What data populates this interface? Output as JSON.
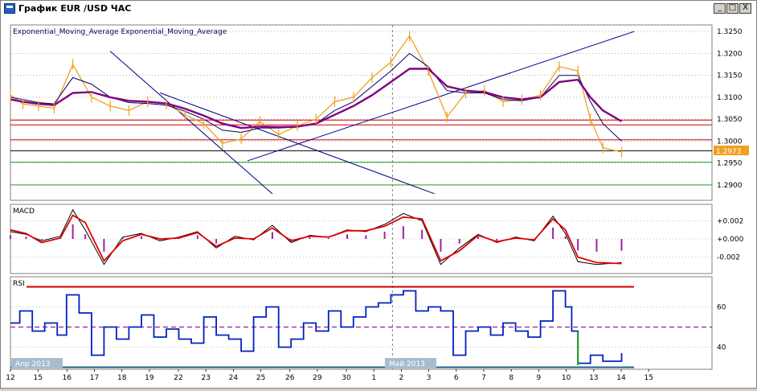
{
  "window": {
    "title": "График EUR /USD  ЧАС",
    "minimize_label": "_",
    "maximize_label": "□",
    "close_label": "X"
  },
  "colors": {
    "price": "#f0a020",
    "ema_fast": "#000060",
    "ema_slow": "#800080",
    "macd_line": "#000000",
    "macd_signal": "#e00000",
    "macd_hist": "#a020a0",
    "rsi": "#0020c0",
    "red_level": "#d00000",
    "green_level": "#20a020",
    "trendline": "#000080",
    "grid": "#808080"
  },
  "chart_data": [
    {
      "type": "line",
      "panel": "price",
      "label": "Exponential_Moving_Average  Exponential_Moving_Average",
      "ylim": [
        1.2865,
        1.3265
      ],
      "yticks": [
        "1.3250",
        "1.3200",
        "1.3150",
        "1.3100",
        "1.3050",
        "1.3000",
        "1.2950",
        "1.2900"
      ],
      "current_price": "1.2973",
      "x": [
        0,
        4,
        9,
        14,
        20,
        26,
        32,
        38,
        44,
        50,
        56,
        62,
        68,
        74,
        80,
        86,
        92,
        98,
        104,
        110,
        116,
        122,
        128,
        134,
        140,
        146,
        152,
        158,
        164,
        170,
        176,
        182,
        186,
        190,
        196
      ],
      "series": [
        {
          "values": [
            1.3105,
            1.3085,
            1.308,
            1.3075,
            1.3175,
            1.31,
            1.308,
            1.307,
            1.309,
            1.3085,
            1.306,
            1.304,
            1.2995,
            1.3005,
            1.3045,
            1.3015,
            1.3035,
            1.305,
            1.309,
            1.31,
            1.3145,
            1.318,
            1.324,
            1.316,
            1.3055,
            1.311,
            1.3115,
            1.309,
            1.3095,
            1.3105,
            1.317,
            1.316,
            1.305,
            1.2985,
            1.2975
          ]
        },
        {
          "values": [
            1.31,
            1.3095,
            1.3088,
            1.3085,
            1.3145,
            1.313,
            1.31,
            1.3088,
            1.3086,
            1.3082,
            1.3068,
            1.305,
            1.3025,
            1.302,
            1.303,
            1.303,
            1.3032,
            1.304,
            1.307,
            1.309,
            1.3125,
            1.316,
            1.32,
            1.317,
            1.3115,
            1.311,
            1.311,
            1.3095,
            1.3092,
            1.31,
            1.315,
            1.315,
            1.309,
            1.304,
            1.3
          ]
        },
        {
          "values": [
            1.3095,
            1.309,
            1.3085,
            1.3082,
            1.311,
            1.3112,
            1.31,
            1.3092,
            1.309,
            1.3086,
            1.3074,
            1.3058,
            1.304,
            1.303,
            1.3033,
            1.3032,
            1.3033,
            1.304,
            1.306,
            1.308,
            1.3105,
            1.3135,
            1.3165,
            1.3165,
            1.3125,
            1.3115,
            1.3112,
            1.31,
            1.3095,
            1.31,
            1.3135,
            1.314,
            1.31,
            1.307,
            1.3045
          ]
        }
      ],
      "levels_red": [
        1.3048,
        1.3037,
        1.3003
      ],
      "levels_green": [
        1.2952,
        1.29
      ],
      "level_black": 1.2978
    },
    {
      "type": "line",
      "panel": "macd",
      "label": "MACD",
      "ylim": [
        -0.0038,
        0.0038
      ],
      "yticks": [
        "+0.002",
        "+0.000",
        "-0.002"
      ],
      "x": [
        0,
        5,
        10,
        16,
        20,
        24,
        30,
        36,
        42,
        48,
        54,
        60,
        66,
        72,
        78,
        84,
        90,
        96,
        102,
        108,
        114,
        120,
        126,
        132,
        138,
        144,
        150,
        156,
        162,
        168,
        174,
        178,
        182,
        188,
        196
      ],
      "series": [
        {
          "values": [
            0.0008,
            0.0005,
            -0.0002,
            0.0003,
            0.0032,
            0.001,
            -0.0028,
            0.0002,
            0.0006,
            -0.0002,
            0.0002,
            0.0008,
            -0.001,
            0.0003,
            -0.0001,
            0.0015,
            -0.0004,
            0.0004,
            0.0002,
            0.001,
            0.0008,
            0.0016,
            0.0028,
            0.002,
            -0.0028,
            -0.001,
            0.0005,
            -0.0004,
            0.0002,
            -0.0002,
            0.0025,
            0.0006,
            -0.0025,
            -0.0028,
            -0.0026
          ]
        },
        {
          "values": [
            0.001,
            0.0006,
            -0.0004,
            0.0001,
            0.0026,
            0.0018,
            -0.0024,
            -0.0002,
            0.0005,
            0.0,
            0.0001,
            0.0007,
            -0.0008,
            0.0001,
            0.0,
            0.0012,
            -0.0002,
            0.0003,
            0.0002,
            0.0009,
            0.0009,
            0.0014,
            0.0024,
            0.0022,
            -0.0024,
            -0.0013,
            0.0004,
            -0.0003,
            0.0001,
            -0.0001,
            0.0022,
            0.001,
            -0.002,
            -0.0026,
            -0.0027
          ]
        }
      ]
    },
    {
      "type": "line",
      "panel": "rsi",
      "label": "RSI",
      "ylim": [
        29,
        75
      ],
      "yticks": [
        "60",
        "40"
      ],
      "levels": [
        70,
        50,
        30
      ],
      "x": [
        0,
        3,
        7,
        11,
        15,
        18,
        22,
        26,
        30,
        34,
        38,
        42,
        46,
        50,
        54,
        58,
        62,
        66,
        70,
        74,
        78,
        82,
        86,
        90,
        94,
        98,
        102,
        106,
        110,
        114,
        118,
        122,
        126,
        130,
        134,
        138,
        142,
        146,
        150,
        154,
        158,
        162,
        166,
        170,
        174,
        178,
        180,
        182,
        186,
        190,
        196
      ],
      "series": [
        {
          "values": [
            52,
            58,
            48,
            52,
            46,
            66,
            57,
            36,
            50,
            44,
            50,
            56,
            45,
            49,
            44,
            42,
            55,
            46,
            44,
            38,
            55,
            60,
            40,
            44,
            52,
            48,
            58,
            50,
            55,
            60,
            62,
            66,
            68,
            58,
            60,
            58,
            36,
            48,
            50,
            46,
            52,
            48,
            45,
            53,
            68,
            60,
            48,
            32,
            36,
            33,
            37
          ]
        }
      ]
    }
  ],
  "x_axis": {
    "tick_labels": [
      "12",
      "15",
      "16",
      "17",
      "18",
      "19",
      "22",
      "23",
      "24",
      "25",
      "26",
      "29",
      "30",
      "1",
      "2",
      "3",
      "6",
      "7",
      "8",
      "9",
      "10",
      "13",
      "14",
      "15"
    ],
    "period_labels": [
      "Апр 2013",
      "Май 2013"
    ]
  }
}
